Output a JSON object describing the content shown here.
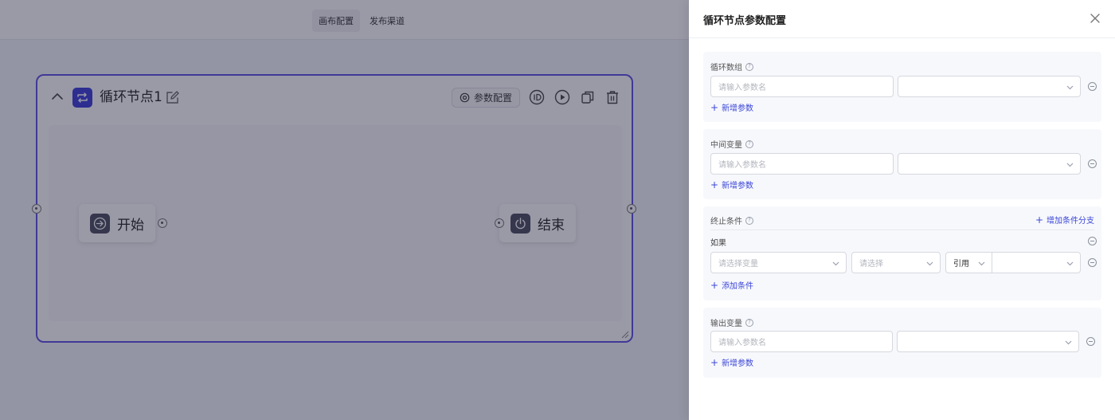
{
  "topbar": {
    "tabs": [
      "画布配置",
      "发布渠道"
    ]
  },
  "loop_node": {
    "title": "循环节点1",
    "params_button": "参数配置",
    "start_label": "开始",
    "end_label": "结束"
  },
  "drawer": {
    "title": "循环节点参数配置",
    "loop_array": {
      "label": "循环数组",
      "name_placeholder": "请输入参数名",
      "add_label": "新增参数"
    },
    "intermediate": {
      "label": "中间变量",
      "name_placeholder": "请输入参数名",
      "add_label": "新增参数"
    },
    "stop_condition": {
      "label": "终止条件",
      "add_branch_label": "增加条件分支",
      "if_label": "如果",
      "variable_placeholder": "请选择变量",
      "operator_placeholder": "请选择",
      "ref_value": "引用",
      "add_condition_label": "添加条件"
    },
    "output": {
      "label": "输出变量",
      "name_placeholder": "请输入参数名",
      "add_label": "新增参数"
    }
  },
  "colors": {
    "accent": "#3b46d8",
    "node_border": "#5b4fe0",
    "node_icon": "#3a3bd6",
    "mask": "rgba(30,30,60,0.45)"
  }
}
